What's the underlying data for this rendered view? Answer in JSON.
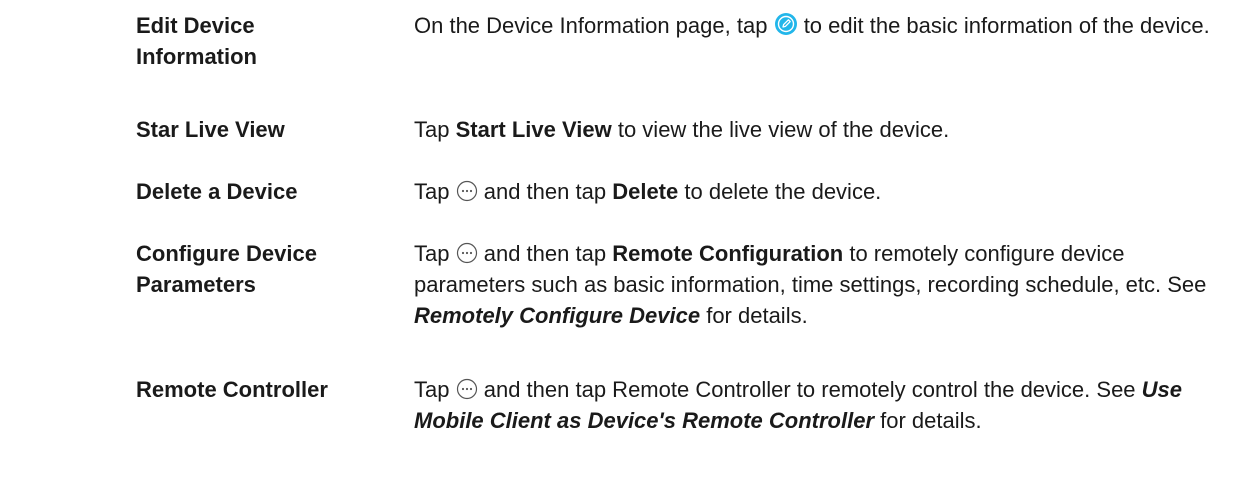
{
  "rows": [
    {
      "term": "Edit Device Information",
      "term_lines": [
        "Edit Device",
        "Information"
      ],
      "desc_pre": "On the Device Information page, tap",
      "icon": "edit-pencil-icon",
      "desc_post": "to edit the basic information of the device."
    },
    {
      "term": "Star Live View",
      "desc_pre": "Tap",
      "desc_bold": "Start Live View",
      "desc_post": "to view the live view of the device."
    },
    {
      "term": "Delete a Device",
      "desc_pre": "Tap",
      "icon": "more-options-icon",
      "desc_mid": "and then tap",
      "desc_bold": "Delete",
      "desc_post": "to delete the device."
    },
    {
      "term": "Configure Device Parameters",
      "term_lines": [
        "Configure Device",
        "Parameters"
      ],
      "desc_pre": "Tap",
      "icon": "more-options-icon",
      "desc_mid": "and then tap",
      "desc_bold": "Remote Configuration",
      "desc_post": "to remotely configure device parameters such as basic information, time settings, recording schedule, etc. See",
      "desc_link": "Remotely Configure Device",
      "desc_tail": "for details."
    },
    {
      "term": "Remote Controller",
      "desc_pre": "Tap",
      "icon": "more-options-icon",
      "desc_post": "and then tap Remote Controller to remotely control the device. See",
      "desc_link": "Use Mobile Client as Device's Remote Controller",
      "desc_tail": "for details."
    }
  ],
  "colors": {
    "text": "#1a1a1a",
    "edit_icon_fill": "#22b6ea",
    "more_icon_stroke": "#555555"
  }
}
